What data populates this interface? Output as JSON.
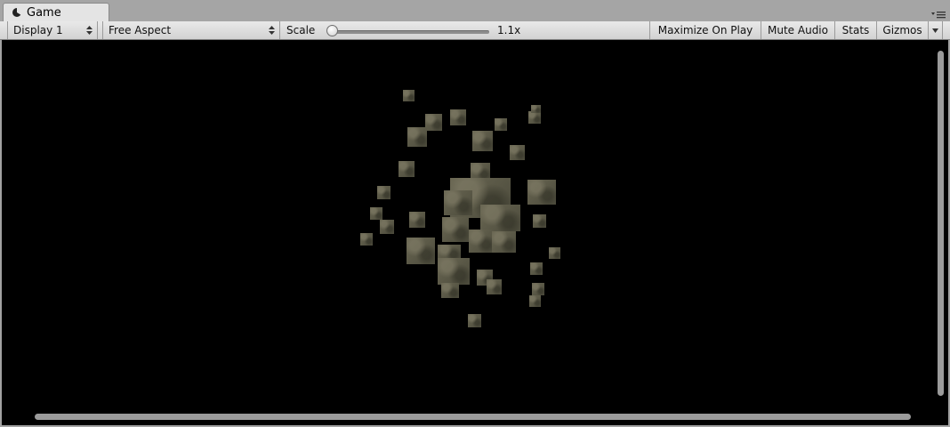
{
  "tab": {
    "title": "Game",
    "icon": "pacman-icon"
  },
  "toolbar": {
    "display": "Display 1",
    "aspect": "Free Aspect",
    "scale_label": "Scale",
    "scale_value": "1.1x",
    "scale_slider_fraction": 0.03,
    "maximize_on_play": "Maximize On Play",
    "mute_audio": "Mute Audio",
    "stats": "Stats",
    "gizmos": "Gizmos"
  },
  "colors": {
    "background": "#000000",
    "cube": "#5c5a48",
    "toolbar": "#dcdcdc"
  }
}
